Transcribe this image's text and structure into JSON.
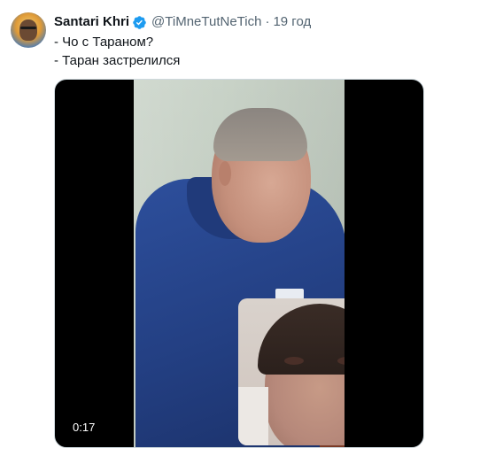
{
  "tweet": {
    "author_name": "Santari Khri",
    "handle": "@TiMneTutNeTich",
    "separator": "·",
    "time": "19 год",
    "lines": [
      "- Чо с Тараном?",
      "- Таран застрелился"
    ],
    "verified_icon": "verified-badge-icon",
    "accent_color": "#1d9bf0"
  },
  "media": {
    "duration": "0:17"
  }
}
